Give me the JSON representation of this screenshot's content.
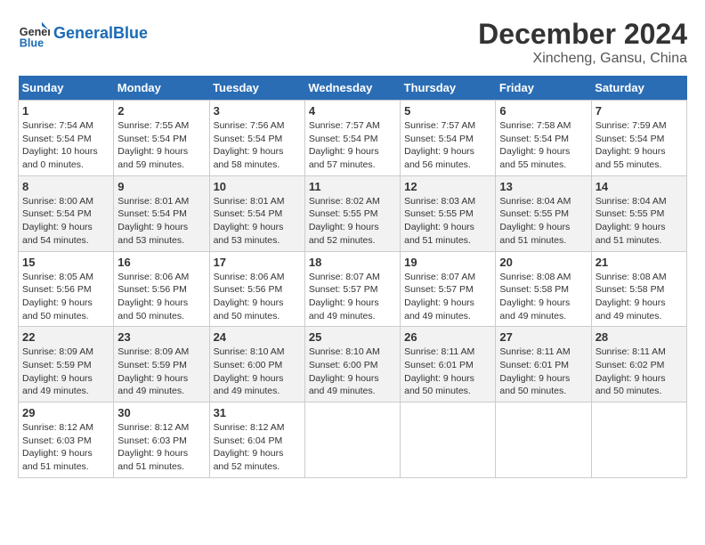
{
  "header": {
    "logo_general": "General",
    "logo_blue": "Blue",
    "month_year": "December 2024",
    "location": "Xincheng, Gansu, China"
  },
  "days_of_week": [
    "Sunday",
    "Monday",
    "Tuesday",
    "Wednesday",
    "Thursday",
    "Friday",
    "Saturday"
  ],
  "weeks": [
    [
      {
        "day": "1",
        "sunrise": "7:54 AM",
        "sunset": "5:54 PM",
        "daylight": "10 hours and 0 minutes."
      },
      {
        "day": "2",
        "sunrise": "7:55 AM",
        "sunset": "5:54 PM",
        "daylight": "9 hours and 59 minutes."
      },
      {
        "day": "3",
        "sunrise": "7:56 AM",
        "sunset": "5:54 PM",
        "daylight": "9 hours and 58 minutes."
      },
      {
        "day": "4",
        "sunrise": "7:57 AM",
        "sunset": "5:54 PM",
        "daylight": "9 hours and 57 minutes."
      },
      {
        "day": "5",
        "sunrise": "7:57 AM",
        "sunset": "5:54 PM",
        "daylight": "9 hours and 56 minutes."
      },
      {
        "day": "6",
        "sunrise": "7:58 AM",
        "sunset": "5:54 PM",
        "daylight": "9 hours and 55 minutes."
      },
      {
        "day": "7",
        "sunrise": "7:59 AM",
        "sunset": "5:54 PM",
        "daylight": "9 hours and 55 minutes."
      }
    ],
    [
      {
        "day": "8",
        "sunrise": "8:00 AM",
        "sunset": "5:54 PM",
        "daylight": "9 hours and 54 minutes."
      },
      {
        "day": "9",
        "sunrise": "8:01 AM",
        "sunset": "5:54 PM",
        "daylight": "9 hours and 53 minutes."
      },
      {
        "day": "10",
        "sunrise": "8:01 AM",
        "sunset": "5:54 PM",
        "daylight": "9 hours and 53 minutes."
      },
      {
        "day": "11",
        "sunrise": "8:02 AM",
        "sunset": "5:55 PM",
        "daylight": "9 hours and 52 minutes."
      },
      {
        "day": "12",
        "sunrise": "8:03 AM",
        "sunset": "5:55 PM",
        "daylight": "9 hours and 51 minutes."
      },
      {
        "day": "13",
        "sunrise": "8:04 AM",
        "sunset": "5:55 PM",
        "daylight": "9 hours and 51 minutes."
      },
      {
        "day": "14",
        "sunrise": "8:04 AM",
        "sunset": "5:55 PM",
        "daylight": "9 hours and 51 minutes."
      }
    ],
    [
      {
        "day": "15",
        "sunrise": "8:05 AM",
        "sunset": "5:56 PM",
        "daylight": "9 hours and 50 minutes."
      },
      {
        "day": "16",
        "sunrise": "8:06 AM",
        "sunset": "5:56 PM",
        "daylight": "9 hours and 50 minutes."
      },
      {
        "day": "17",
        "sunrise": "8:06 AM",
        "sunset": "5:56 PM",
        "daylight": "9 hours and 50 minutes."
      },
      {
        "day": "18",
        "sunrise": "8:07 AM",
        "sunset": "5:57 PM",
        "daylight": "9 hours and 49 minutes."
      },
      {
        "day": "19",
        "sunrise": "8:07 AM",
        "sunset": "5:57 PM",
        "daylight": "9 hours and 49 minutes."
      },
      {
        "day": "20",
        "sunrise": "8:08 AM",
        "sunset": "5:58 PM",
        "daylight": "9 hours and 49 minutes."
      },
      {
        "day": "21",
        "sunrise": "8:08 AM",
        "sunset": "5:58 PM",
        "daylight": "9 hours and 49 minutes."
      }
    ],
    [
      {
        "day": "22",
        "sunrise": "8:09 AM",
        "sunset": "5:59 PM",
        "daylight": "9 hours and 49 minutes."
      },
      {
        "day": "23",
        "sunrise": "8:09 AM",
        "sunset": "5:59 PM",
        "daylight": "9 hours and 49 minutes."
      },
      {
        "day": "24",
        "sunrise": "8:10 AM",
        "sunset": "6:00 PM",
        "daylight": "9 hours and 49 minutes."
      },
      {
        "day": "25",
        "sunrise": "8:10 AM",
        "sunset": "6:00 PM",
        "daylight": "9 hours and 49 minutes."
      },
      {
        "day": "26",
        "sunrise": "8:11 AM",
        "sunset": "6:01 PM",
        "daylight": "9 hours and 50 minutes."
      },
      {
        "day": "27",
        "sunrise": "8:11 AM",
        "sunset": "6:01 PM",
        "daylight": "9 hours and 50 minutes."
      },
      {
        "day": "28",
        "sunrise": "8:11 AM",
        "sunset": "6:02 PM",
        "daylight": "9 hours and 50 minutes."
      }
    ],
    [
      {
        "day": "29",
        "sunrise": "8:12 AM",
        "sunset": "6:03 PM",
        "daylight": "9 hours and 51 minutes."
      },
      {
        "day": "30",
        "sunrise": "8:12 AM",
        "sunset": "6:03 PM",
        "daylight": "9 hours and 51 minutes."
      },
      {
        "day": "31",
        "sunrise": "8:12 AM",
        "sunset": "6:04 PM",
        "daylight": "9 hours and 52 minutes."
      },
      null,
      null,
      null,
      null
    ]
  ]
}
